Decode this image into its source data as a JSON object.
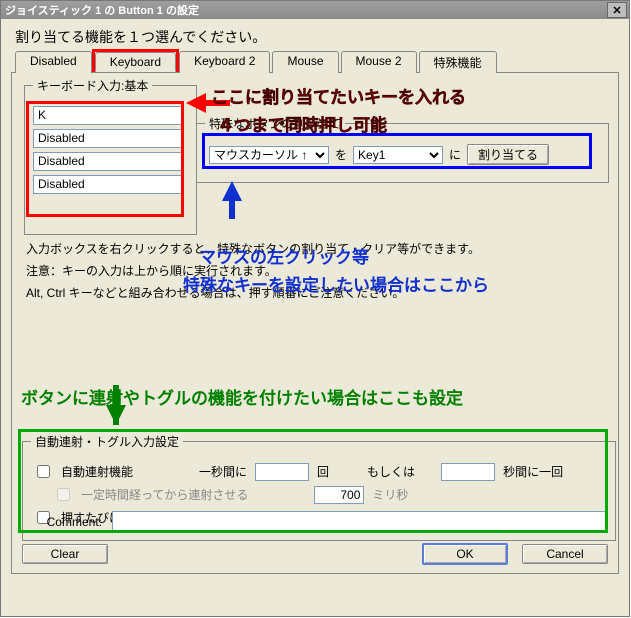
{
  "title": "ジョイスティック 1 の Button 1 の設定",
  "instruction": "割り当てる機能を１つ選んでください。",
  "tabs": [
    "Disabled",
    "Keyboard",
    "Keyboard 2",
    "Mouse",
    "Mouse 2",
    "特殊機能"
  ],
  "active_tab": 1,
  "kb_legend": "キーボード入力:基本",
  "kb_inputs": [
    "K",
    "Disabled",
    "Disabled",
    "Disabled"
  ],
  "special": {
    "legend": "特殊なボタンの割り当て",
    "select1": "マウスカーソル ↑",
    "label_wo": "を",
    "select2": "Key1",
    "label_ni": "に",
    "assign_btn": "割り当てる"
  },
  "notes": {
    "line1": "入力ボックスを右クリックすると、特殊なボタンの割り当て・クリア等ができます。",
    "line2": "注意：キーの入力は上から順に実行されます。",
    "line3": "Alt, Ctrl キーなどと組み合わせる場合は、押す順番にご注意ください。"
  },
  "repeat": {
    "legend": "自動連射・トグル入力設定",
    "auto_label": "自動連射機能",
    "per_sec_a": "一秒間に",
    "per_sec_b": "回",
    "or_label": "もしくは",
    "per_sec_c": "秒間に一回",
    "delay_label": "一定時間経ってから連射させる",
    "delay_value": "700",
    "delay_unit": "ミリ秒",
    "toggle_label": "押すたびに ON/OFF 切り替え（トグル）"
  },
  "comment_label": "Comment:",
  "buttons": {
    "clear": "Clear",
    "ok": "OK",
    "cancel": "Cancel"
  },
  "anno": {
    "red1": "ここに割り当てたいキーを入れる",
    "red2": "４つまで同時押し可能",
    "blue1": "マウスの左クリック等",
    "blue2": "特殊なキーを設定したい場合はここから",
    "green": "ボタンに連射やトグルの機能を付けたい場合はここも設定"
  }
}
